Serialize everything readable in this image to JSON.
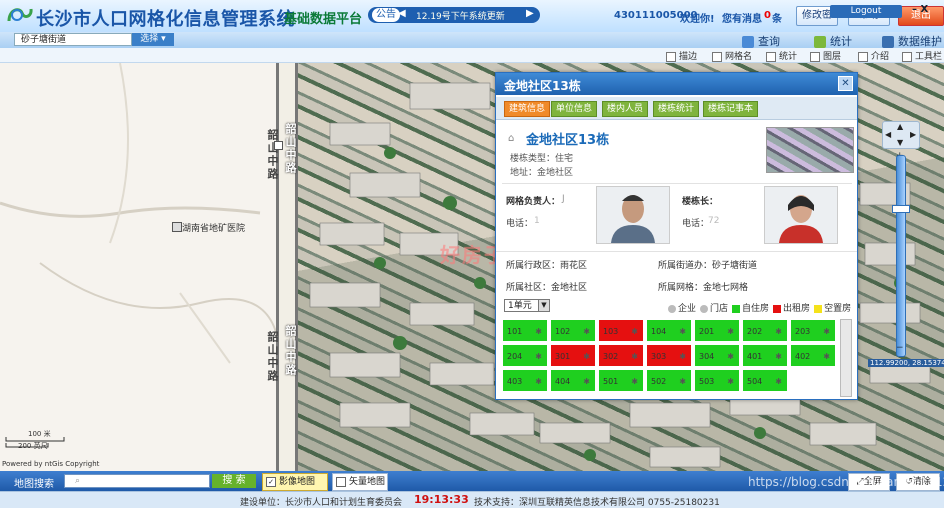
{
  "header": {
    "app_title": "长沙市人口网格化信息管理系统",
    "platform": "基础数据平台",
    "notice_label": "公告",
    "notice_text": "12.19号下午系统更新",
    "user_id": "430111005000",
    "welcome": "欢迎你!",
    "msg_label": "您有消息",
    "msg_count": "0",
    "msg_unit": "条",
    "modify_label": "修改密",
    "help_label": "帮助",
    "exit_label": "退出",
    "logout_label": "Logout",
    "close_mark": "– X"
  },
  "toolbar": {
    "street_value": "砂子塘街道",
    "choose_label": "选择",
    "query_label": "查询",
    "stats_label": "统计",
    "maintain_label": "数据维护"
  },
  "layers": [
    "描边",
    "网格名",
    "统计",
    "图层",
    "介绍",
    "工具栏"
  ],
  "map": {
    "road_name": "韶山中路",
    "poi_name": "湖南省地矿医院",
    "scale_100": "100 米",
    "scale_200": "200 英尺",
    "powered": "Powered by ntGis Copyright",
    "coords": "112.99200, 28.15374",
    "watermark": "好房子"
  },
  "popup": {
    "title": "金地社区13栋",
    "tabs": [
      "建筑信息",
      "单位信息",
      "楼内人员",
      "楼栋统计",
      "楼栋记事本"
    ],
    "building_name": "金地社区13栋",
    "building_type": "楼栋类型：住宅",
    "building_address": "地址：金地社区",
    "manager_label": "网格负责人：",
    "manager_name": "J",
    "manager_tel_label": "电话：",
    "manager_tel": "1",
    "head_label": "楼栋长：",
    "head_name": "",
    "head_tel_label": "电话：",
    "head_tel": "72",
    "district": "所属行政区：雨花区",
    "street": "所属街道办：砂子塘街道",
    "community": "所属社区：金地社区",
    "grid": "所属网格：金地七网格",
    "unit_select": "1单元",
    "legend": [
      {
        "label": "企业",
        "color": "#bbbbbb",
        "type": "dot"
      },
      {
        "label": "门店",
        "color": "#bbbbbb",
        "type": "dot"
      },
      {
        "label": "自住房",
        "color": "#1fcf1f",
        "type": "box"
      },
      {
        "label": "出租房",
        "color": "#e51010",
        "type": "box"
      },
      {
        "label": "空置房",
        "color": "#f5e21a",
        "type": "box"
      }
    ],
    "rooms": [
      {
        "no": "101",
        "status": "self"
      },
      {
        "no": "102",
        "status": "self"
      },
      {
        "no": "103",
        "status": "rent"
      },
      {
        "no": "104",
        "status": "self"
      },
      {
        "no": "201",
        "status": "self"
      },
      {
        "no": "202",
        "status": "self"
      },
      {
        "no": "203",
        "status": "self"
      },
      {
        "no": "204",
        "status": "self"
      },
      {
        "no": "301",
        "status": "rent"
      },
      {
        "no": "302",
        "status": "rent"
      },
      {
        "no": "303",
        "status": "rent"
      },
      {
        "no": "304",
        "status": "self"
      },
      {
        "no": "401",
        "status": "self"
      },
      {
        "no": "402",
        "status": "self"
      },
      {
        "no": "403",
        "status": "self"
      },
      {
        "no": "404",
        "status": "self"
      },
      {
        "no": "501",
        "status": "self"
      },
      {
        "no": "502",
        "status": "self"
      },
      {
        "no": "503",
        "status": "self"
      },
      {
        "no": "504",
        "status": "self"
      }
    ],
    "colors": {
      "self": "#1fcf1f",
      "rent": "#e51010",
      "vacant": "#f5e21a"
    }
  },
  "bottom": {
    "search_label": "地图搜索",
    "search_placeholder": "",
    "search_button": "搜 索",
    "image_map": "影像地图",
    "vector_map": "矢量地图",
    "fullscreen": "全屏",
    "clear": "清除"
  },
  "footer": {
    "builder": "建设单位：长沙市人口和计划生育委员会",
    "time": "19:13:33",
    "support": "技术支持：深圳互联精英信息技术有限公司  0755-25180231",
    "watermark": "https://blog.csdn.net/wangiu1112"
  }
}
